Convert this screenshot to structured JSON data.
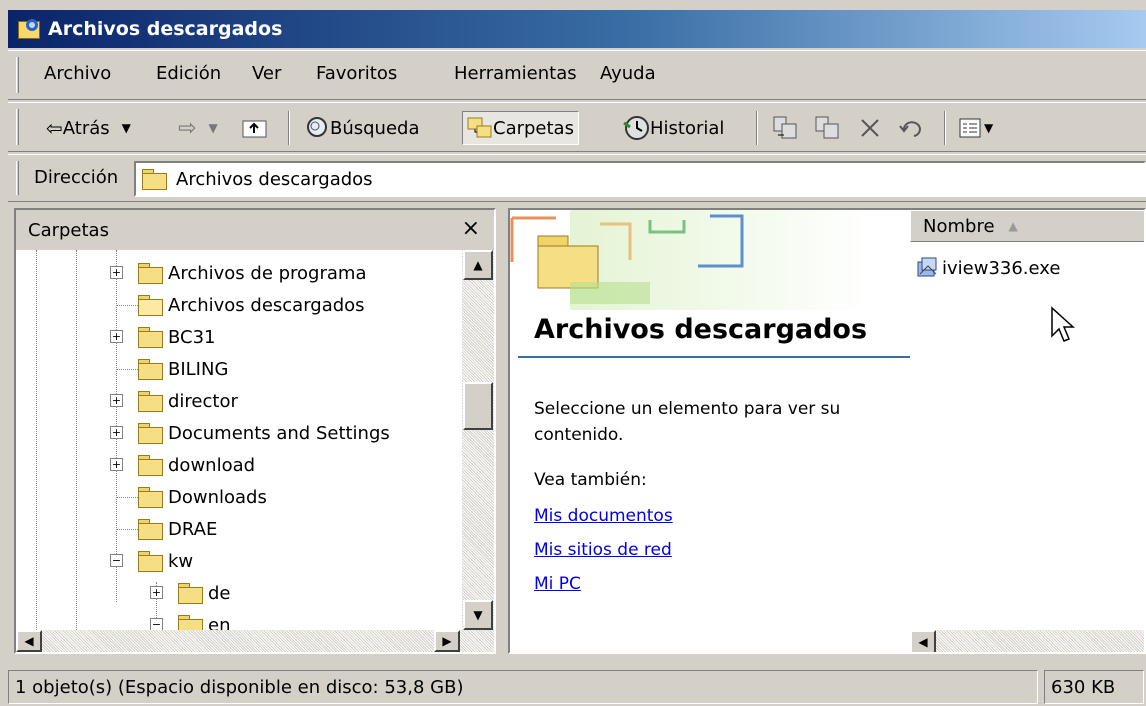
{
  "window": {
    "title": "Archivos descargados"
  },
  "menu": [
    "Archivo",
    "Edición",
    "Ver",
    "Favoritos",
    "Herramientas",
    "Ayuda"
  ],
  "toolbar": {
    "back": "Atrás",
    "search": "Búsqueda",
    "folders": "Carpetas",
    "history": "Historial"
  },
  "address": {
    "label": "Dirección",
    "value": "Archivos descargados"
  },
  "folders_pane": {
    "title": "Carpetas",
    "close": "×",
    "items": [
      "Archivos de programa",
      "Archivos descargados",
      "BC31",
      "BILING",
      "director",
      "Documents and Settings",
      "download",
      "Downloads",
      "DRAE",
      "kw",
      "de",
      "en"
    ]
  },
  "webview": {
    "title": "Archivos descargados",
    "description": "Seleccione un elemento para ver su contenido.",
    "see_also": "Vea también:",
    "links": [
      "Mis documentos",
      "Mis sitios de red",
      "Mi PC"
    ]
  },
  "filelist": {
    "column_name": "Nombre",
    "files": [
      "iview336.exe"
    ]
  },
  "status": {
    "text": "1 objeto(s) (Espacio disponible en disco:  53,8 GB)",
    "size": "630 KB"
  }
}
